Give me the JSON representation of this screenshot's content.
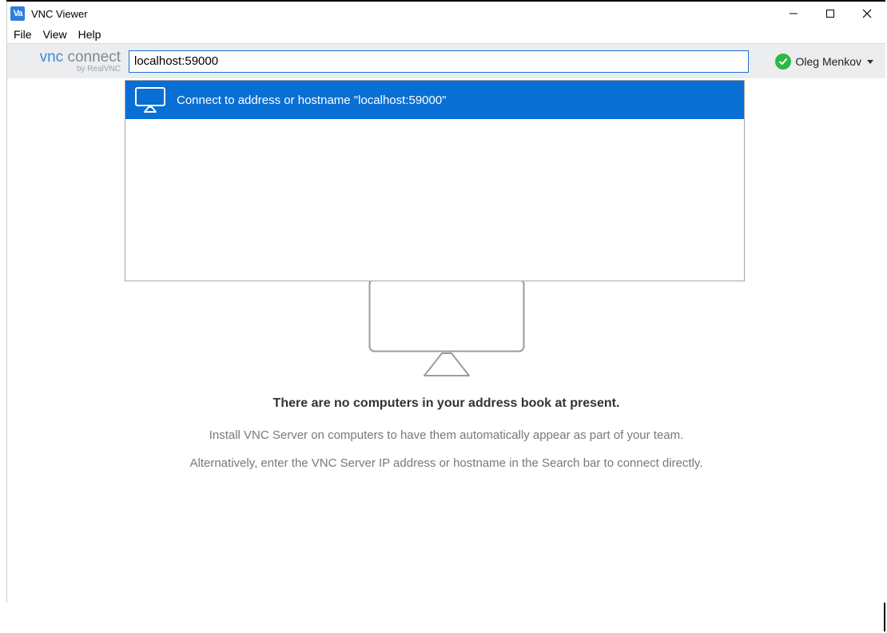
{
  "window": {
    "title": "VNC Viewer"
  },
  "menu": {
    "file": "File",
    "view": "View",
    "help": "Help"
  },
  "brand": {
    "part1": "vnc ",
    "part2": "connect",
    "sub": "by RealVNC"
  },
  "search": {
    "value": "localhost:59000",
    "suggestion_label": "Connect to address or hostname \"localhost:59000\""
  },
  "account": {
    "name": "Oleg Menkov"
  },
  "empty": {
    "title": "There are no computers in your address book at present.",
    "line1": "Install VNC Server on computers to have them automatically appear as part of your team.",
    "line2": "Alternatively, enter the VNC Server IP address or hostname in the Search bar to connect directly."
  },
  "icons": {
    "app": "Va",
    "minimize": "minimize-icon",
    "maximize": "maximize-icon",
    "close": "close-icon",
    "check": "check-icon",
    "caret": "chevron-down-icon",
    "monitor": "monitor-icon"
  }
}
